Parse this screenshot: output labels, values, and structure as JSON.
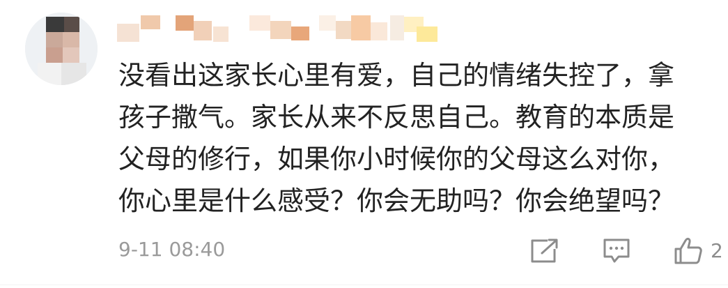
{
  "comment": {
    "lines": [
      "没看出这家长心里有爱，自己的情绪失控了，拿",
      "孩子撒气。家长从来不反思自己。教育的本质是",
      "父母的修行，如果你小时候你的父母这么对你，",
      "你心里是什么感受？你会无助吗？你会绝望吗？"
    ],
    "timestamp": "9-11 08:40"
  },
  "actions": {
    "share_icon": "share-icon",
    "reply_icon": "comment-icon",
    "like_icon": "thumbs-up-icon",
    "like_count": "2"
  },
  "colors": {
    "text": "#222222",
    "meta": "#9a9a9a",
    "icon": "#8c8c8c"
  }
}
